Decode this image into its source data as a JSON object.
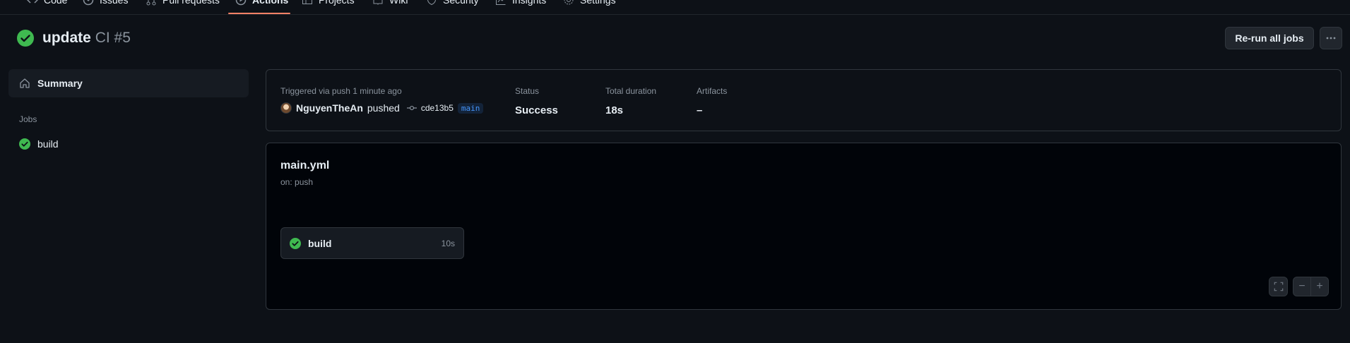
{
  "nav": {
    "tabs": [
      {
        "label": "Code",
        "icon": "code-icon"
      },
      {
        "label": "Issues",
        "icon": "issue-icon"
      },
      {
        "label": "Pull requests",
        "icon": "pull-request-icon"
      },
      {
        "label": "Actions",
        "icon": "play-icon",
        "active": true
      },
      {
        "label": "Projects",
        "icon": "table-icon"
      },
      {
        "label": "Wiki",
        "icon": "book-icon"
      },
      {
        "label": "Security",
        "icon": "shield-icon"
      },
      {
        "label": "Insights",
        "icon": "graph-icon"
      },
      {
        "label": "Settings",
        "icon": "gear-icon"
      }
    ]
  },
  "header": {
    "title": "update",
    "workflow_run": "CI #5",
    "status_icon": "check-circle-icon",
    "rerun_label": "Re-run all jobs",
    "more_icon": "kebab-horizontal-icon"
  },
  "sidebar": {
    "summary_label": "Summary",
    "summary_icon": "home-icon",
    "jobs_heading": "Jobs",
    "jobs": [
      {
        "label": "build",
        "icon": "check-circle-icon"
      }
    ]
  },
  "summary": {
    "trigger_text": "Triggered via push 1 minute ago",
    "user": "NguyenTheAn",
    "action": "pushed",
    "commit": "cde13b5",
    "branch": "main",
    "status_label": "Status",
    "status_value": "Success",
    "duration_label": "Total duration",
    "duration_value": "18s",
    "artifacts_label": "Artifacts",
    "artifacts_value": "–"
  },
  "graph": {
    "workflow_file": "main.yml",
    "trigger": "on: push",
    "job": {
      "name": "build",
      "duration": "10s"
    },
    "controls": {
      "fullscreen_icon": "screen-full-icon",
      "zoom_out": "−",
      "zoom_in": "+"
    }
  },
  "colors": {
    "background": "#0d1117",
    "success": "#3fb950",
    "active_tab_underline": "#f78166",
    "branch": "#4493f8"
  }
}
